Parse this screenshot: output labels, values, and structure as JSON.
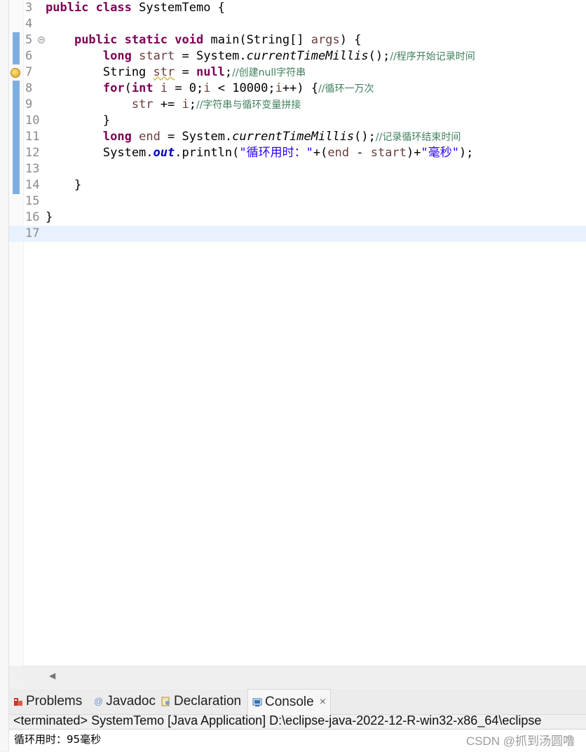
{
  "editor": {
    "lines": [
      {
        "num": "3",
        "tokens": [
          [
            "kw",
            "public"
          ],
          [
            "plain",
            " "
          ],
          [
            "kw",
            "class"
          ],
          [
            "plain",
            " SystemTemo {"
          ]
        ]
      },
      {
        "num": "4",
        "tokens": []
      },
      {
        "num": "5",
        "fold": true,
        "tokens": [
          [
            "plain",
            "    "
          ],
          [
            "kw",
            "public"
          ],
          [
            "plain",
            " "
          ],
          [
            "kw",
            "static"
          ],
          [
            "plain",
            " "
          ],
          [
            "kw",
            "void"
          ],
          [
            "plain",
            " main(String[] "
          ],
          [
            "var",
            "args"
          ],
          [
            "plain",
            ") {"
          ]
        ]
      },
      {
        "num": "6",
        "tokens": [
          [
            "plain",
            "        "
          ],
          [
            "kw",
            "long"
          ],
          [
            "plain",
            " "
          ],
          [
            "var",
            "start"
          ],
          [
            "plain",
            " = System."
          ],
          [
            "method-static",
            "currentTimeMillis"
          ],
          [
            "plain",
            "();"
          ],
          [
            "cmt",
            "//程序开始记录时间"
          ]
        ]
      },
      {
        "num": "7",
        "warning": true,
        "tokens": [
          [
            "plain",
            "        String "
          ],
          [
            "var squiggle",
            "str"
          ],
          [
            "plain",
            " = "
          ],
          [
            "kw",
            "null"
          ],
          [
            "plain",
            ";"
          ],
          [
            "cmt",
            "//创建null字符串"
          ]
        ]
      },
      {
        "num": "8",
        "tokens": [
          [
            "plain",
            "        "
          ],
          [
            "kw",
            "for"
          ],
          [
            "plain",
            "("
          ],
          [
            "kw",
            "int"
          ],
          [
            "plain",
            " "
          ],
          [
            "var",
            "i"
          ],
          [
            "plain",
            " = 0;"
          ],
          [
            "var",
            "i"
          ],
          [
            "plain",
            " < 10000;"
          ],
          [
            "var",
            "i"
          ],
          [
            "plain",
            "++) {"
          ],
          [
            "cmt",
            "//循环一万次"
          ]
        ]
      },
      {
        "num": "9",
        "tokens": [
          [
            "plain",
            "            "
          ],
          [
            "var",
            "str"
          ],
          [
            "plain",
            " += "
          ],
          [
            "var",
            "i"
          ],
          [
            "plain",
            ";"
          ],
          [
            "cmt",
            "//字符串与循环变量拼接"
          ]
        ]
      },
      {
        "num": "10",
        "tokens": [
          [
            "plain",
            "        }"
          ]
        ]
      },
      {
        "num": "11",
        "tokens": [
          [
            "plain",
            "        "
          ],
          [
            "kw",
            "long"
          ],
          [
            "plain",
            " "
          ],
          [
            "var",
            "end"
          ],
          [
            "plain",
            " = System."
          ],
          [
            "method-static",
            "currentTimeMillis"
          ],
          [
            "plain",
            "();"
          ],
          [
            "cmt",
            "//记录循环结束时间"
          ]
        ]
      },
      {
        "num": "12",
        "tokens": [
          [
            "plain",
            "        System."
          ],
          [
            "field",
            "out"
          ],
          [
            "plain",
            ".println("
          ],
          [
            "str",
            "\"循环用时：\""
          ],
          [
            "plain",
            "+("
          ],
          [
            "var",
            "end"
          ],
          [
            "plain",
            " - "
          ],
          [
            "var",
            "start"
          ],
          [
            "plain",
            ")+"
          ],
          [
            "str",
            "\"毫秒\""
          ],
          [
            "plain",
            ");"
          ]
        ]
      },
      {
        "num": "13",
        "tokens": []
      },
      {
        "num": "14",
        "tokens": [
          [
            "plain",
            "    }"
          ]
        ]
      },
      {
        "num": "15",
        "tokens": []
      },
      {
        "num": "16",
        "tokens": [
          [
            "plain",
            "}"
          ]
        ]
      },
      {
        "num": "17",
        "current": true,
        "tokens": []
      }
    ]
  },
  "panel": {
    "tabs": [
      {
        "label": "Problems",
        "icon": "problems-icon"
      },
      {
        "label": "Javadoc",
        "icon": "javadoc-icon"
      },
      {
        "label": "Declaration",
        "icon": "declaration-icon"
      },
      {
        "label": "Console",
        "icon": "console-icon",
        "active": true,
        "close": "×"
      }
    ],
    "console_header": "<terminated> SystemTemo [Java Application] D:\\eclipse-java-2022-12-R-win32-x86_64\\eclipse",
    "console_output": "循环用时：95毫秒"
  },
  "watermark": "CSDN @抓到汤圆噜"
}
